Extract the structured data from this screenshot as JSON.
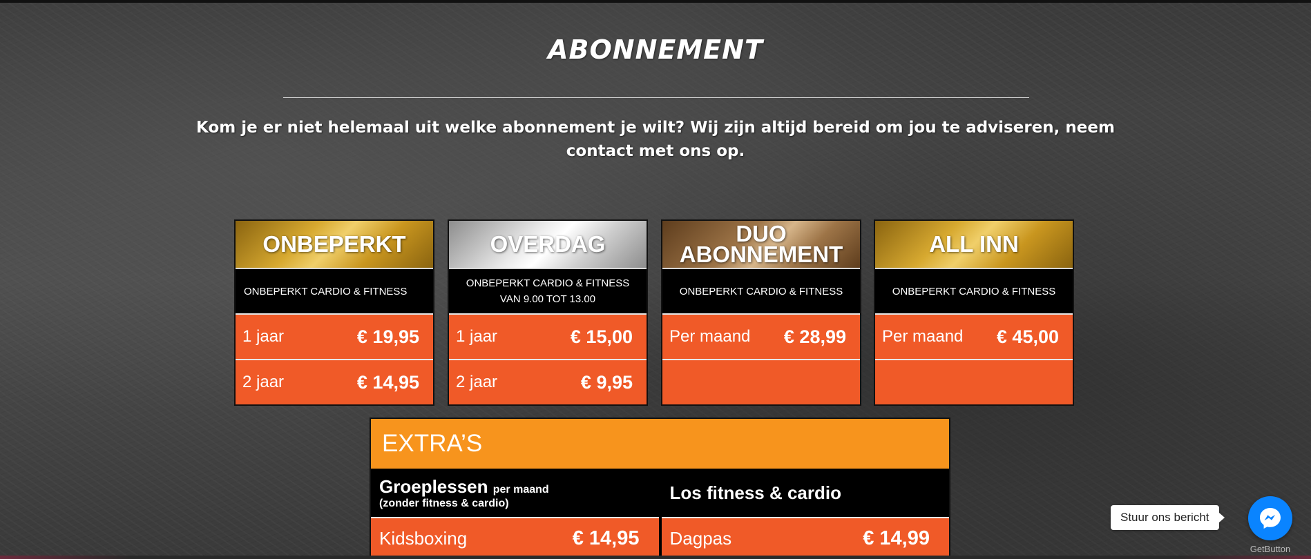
{
  "title": "ABONNEMENT",
  "intro": "Kom je er niet helemaal uit welke abonnement je wilt? Wij zijn altijd bereid om jou te adviseren, neem contact met ons op.",
  "cards": [
    {
      "name": "ONBEPERKT",
      "subtitle": "ONBEPERKT CARDIO & FITNESS",
      "rows": [
        {
          "label": "1 jaar",
          "price": "€ 19,95"
        },
        {
          "label": "2 jaar",
          "price": "€ 14,95"
        }
      ]
    },
    {
      "name": "OVERDAG",
      "subtitle_line1": "ONBEPERKT CARDIO & FITNESS",
      "subtitle_line2": "VAN 9.00 TOT 13.00",
      "rows": [
        {
          "label": "1 jaar",
          "price": "€ 15,00"
        },
        {
          "label": "2 jaar",
          "price": "€ 9,95"
        }
      ]
    },
    {
      "name_line1": "DUO",
      "name_line2": "ABONNEMENT",
      "subtitle": "ONBEPERKT CARDIO & FITNESS",
      "rows": [
        {
          "label": "Per maand",
          "price": "€ 28,99"
        },
        {
          "label": "",
          "price": ""
        }
      ]
    },
    {
      "name": "ALL INN",
      "subtitle": "ONBEPERKT CARDIO & FITNESS",
      "rows": [
        {
          "label": "Per maand",
          "price": "€ 45,00"
        },
        {
          "label": "",
          "price": ""
        }
      ]
    }
  ],
  "extras": {
    "title": "EXTRA’S",
    "columns": [
      {
        "title": "Groeplessen",
        "title_suffix": "per maand",
        "note": "(zonder fitness & cardio)",
        "row": {
          "label": "Kidsboxing",
          "price": "€ 14,95"
        }
      },
      {
        "title": "Los fitness & cardio",
        "row": {
          "label": "Dagpas",
          "price": "€ 14,99"
        }
      }
    ]
  },
  "chat": {
    "bubble_text": "Stuur ons bericht",
    "icon": "messenger-icon",
    "powered_by": "GetButton"
  },
  "colors": {
    "orange": "#f05a28",
    "extras_orange": "#f7941d",
    "messenger_blue": "#0a84ff"
  }
}
